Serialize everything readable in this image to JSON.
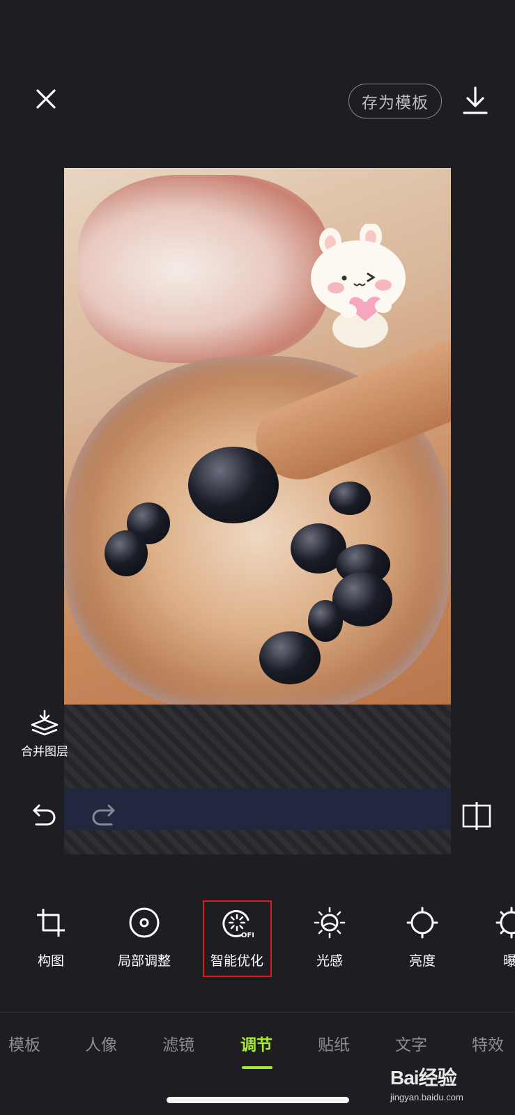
{
  "header": {
    "close_icon": "close-icon",
    "save_template_label": "存为模板",
    "download_icon": "download-icon"
  },
  "canvas": {
    "photo_description_icon": "photo",
    "sticker_icon": "bear-with-heart-sticker"
  },
  "side_actions": {
    "merge_layers_label": "合并图层",
    "undo_icon": "undo-icon",
    "redo_icon": "redo-icon",
    "compare_icon": "compare-icon"
  },
  "adjust_tools": [
    {
      "label": "构图",
      "icon": "crop-icon"
    },
    {
      "label": "局部调整",
      "icon": "local-adjust-icon"
    },
    {
      "label": "智能优化",
      "icon": "smart-optimize-off-icon",
      "badge": "OFF"
    },
    {
      "label": "光感",
      "icon": "light-sense-icon"
    },
    {
      "label": "亮度",
      "icon": "brightness-icon"
    },
    {
      "label": "曝",
      "icon": "exposure-icon"
    }
  ],
  "bottom_tabs": [
    {
      "label": "模板",
      "active": false
    },
    {
      "label": "人像",
      "active": false
    },
    {
      "label": "滤镜",
      "active": false
    },
    {
      "label": "调节",
      "active": true
    },
    {
      "label": "贴纸",
      "active": false
    },
    {
      "label": "文字",
      "active": false
    },
    {
      "label": "特效",
      "active": false
    }
  ],
  "watermark": {
    "brand": "Bai经验",
    "url": "jingyan.baidu.com"
  },
  "colors": {
    "background": "#1e1d21",
    "accent": "#a6e832",
    "highlight_box": "#e01b1b"
  }
}
